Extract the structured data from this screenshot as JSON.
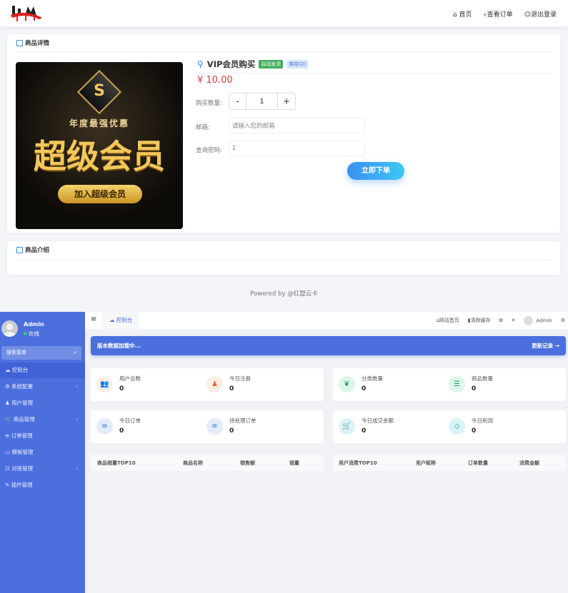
{
  "header": {
    "logo": "HM",
    "nav": [
      {
        "icon": "home-icon",
        "label": "首页"
      },
      {
        "icon": "search-icon",
        "label": "查看订单"
      },
      {
        "icon": "user-icon",
        "label": "退出登录"
      }
    ]
  },
  "detail": {
    "section_title": "商品详情",
    "poster": {
      "top": "年度最强优惠",
      "main": "超级会员",
      "button": "加入超级会员",
      "emblem": "S"
    },
    "product_name": "VIP会员购买",
    "badge_auto": "自动发货",
    "badge_stock": "库存(2)",
    "price": "¥ 10.00",
    "qty_label": "购买数量:",
    "qty_minus": "-",
    "qty_value": "1",
    "qty_plus": "+",
    "email_label": "邮箱:",
    "email_placeholder": "请输入您的邮箱",
    "pwd_label": "查询密码:",
    "pwd_value": "1",
    "buy_button": "立即下单"
  },
  "intro": {
    "section_title": "商品介绍"
  },
  "footer": {
    "powered": "Powered by @红盟云卡"
  },
  "admin": {
    "sidebar": {
      "user": "Admin",
      "status": "在线",
      "search_placeholder": "搜索菜单",
      "items": [
        {
          "icon": "dashboard-icon",
          "glyph": "☁",
          "label": "控制台",
          "active": true
        },
        {
          "icon": "gear-icon",
          "glyph": "⚙",
          "label": "系统配置",
          "sub": true
        },
        {
          "icon": "user-icon",
          "glyph": "♟",
          "label": "用户管理"
        },
        {
          "icon": "cart-icon",
          "glyph": "🛒",
          "label": "商品管理",
          "sub": true
        },
        {
          "icon": "list-icon",
          "glyph": "≡",
          "label": "订单管理"
        },
        {
          "icon": "template-icon",
          "glyph": "▭",
          "label": "模板管理"
        },
        {
          "icon": "sliders-icon",
          "glyph": "☷",
          "label": "对接管理",
          "sub": true
        },
        {
          "icon": "plugin-icon",
          "glyph": "✎",
          "label": "插件管理"
        }
      ]
    },
    "topbar": {
      "tab": "控制台",
      "site_home": "网站首页",
      "clear_cache": "清除缓存",
      "user": "Admin"
    },
    "banner": {
      "left": "版本数据加载中...",
      "right": "更新记录 →"
    },
    "stats": [
      {
        "label": "用户总数",
        "value": "0",
        "icon": "users-icon",
        "glyph": "👥",
        "color": "#f0622f",
        "bg": "#fdeee3"
      },
      {
        "label": "今日注册",
        "value": "0",
        "icon": "user-icon",
        "glyph": "♟",
        "color": "#f0622f",
        "bg": "#fdeee3"
      },
      {
        "label": "分类数量",
        "value": "0",
        "icon": "leaf-icon",
        "glyph": "❦",
        "color": "#18a058",
        "bg": "#ddf5ea"
      },
      {
        "label": "商品数量",
        "value": "0",
        "icon": "list-icon",
        "glyph": "☰",
        "color": "#18a058",
        "bg": "#ddf5ea"
      },
      {
        "label": "今日订单",
        "value": "0",
        "icon": "list-icon",
        "glyph": "≡",
        "color": "#3b6fd8",
        "bg": "#e2ecfb"
      },
      {
        "label": "待处理订单",
        "value": "0",
        "icon": "list-icon",
        "glyph": "≡",
        "color": "#3b6fd8",
        "bg": "#e2ecfb"
      },
      {
        "label": "今日成交金额",
        "value": "0",
        "icon": "cart-icon",
        "glyph": "🛒",
        "color": "#1797a6",
        "bg": "#d9f3f6"
      },
      {
        "label": "今日利润",
        "value": "0",
        "icon": "diamond-icon",
        "glyph": "◇",
        "color": "#1797a6",
        "bg": "#d9f3f6"
      }
    ],
    "table1": [
      "商品销量TOP10",
      "商品名称",
      "销售额",
      "销量"
    ],
    "table2": [
      "用户消费TOP10",
      "用户昵称",
      "订单数量",
      "消费金额"
    ]
  }
}
